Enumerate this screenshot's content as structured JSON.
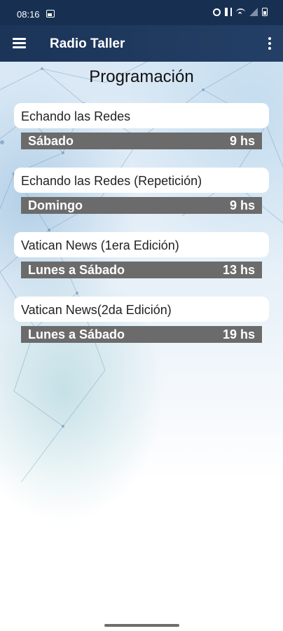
{
  "status_bar": {
    "time": "08:16",
    "icons": [
      "image-icon",
      "alarm-icon",
      "mute-icon",
      "wifi-icon",
      "signal-icon",
      "battery-icon"
    ]
  },
  "app_bar": {
    "title": "Radio Taller",
    "menu_icon": "hamburger-menu-icon",
    "overflow_icon": "more-vert-icon"
  },
  "page": {
    "title": "Programación"
  },
  "programs": [
    {
      "name": "Echando las Redes",
      "day": "Sábado",
      "hour": "9 hs"
    },
    {
      "name": "Echando las Redes (Repetición)",
      "day": "Domingo",
      "hour": "9 hs"
    },
    {
      "name": "Vatican News (1era Edición)",
      "day": "Lunes a Sábado",
      "hour": "13 hs"
    },
    {
      "name": "Vatican News(2da Edición)",
      "day": "Lunes a Sábado",
      "hour": "19 hs"
    }
  ],
  "colors": {
    "app_bar": "#1b3458",
    "row_background": "#6b6b6b",
    "card_background": "#ffffff"
  }
}
